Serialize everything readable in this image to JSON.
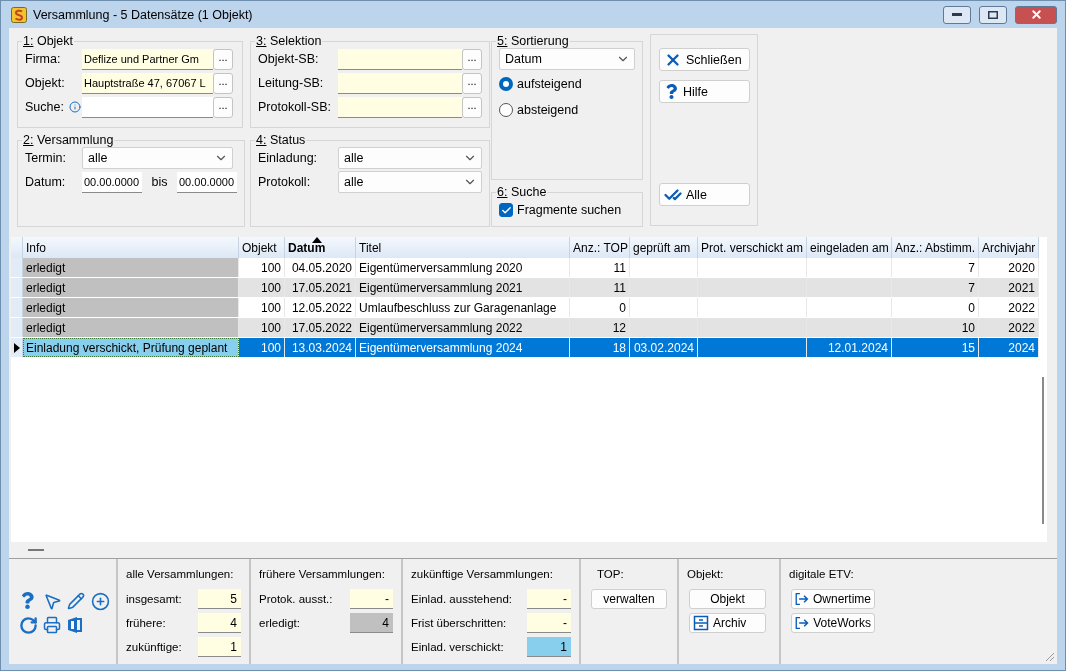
{
  "window": {
    "title": "Versammlung - 5 Datensätze (1 Objekt)"
  },
  "groups": [
    {
      "title": "1: Objekt",
      "rows": [
        {
          "kind": "lookup",
          "label": "Firma:",
          "value": "Deflize und Partner Gm",
          "browse": "...",
          "color": "#fffde2"
        },
        {
          "kind": "lookup",
          "label": "Objekt:",
          "value": "Hauptstraße 47, 67067 L",
          "browse": "...",
          "color": "#fffde2"
        },
        {
          "kind": "lookup",
          "label": "Suche:",
          "info": true,
          "browse": "...",
          "color": "#ffffff"
        }
      ]
    },
    {
      "title": "2: Versammlung",
      "rows": [
        {
          "kind": "dropdown",
          "label": "Termin:",
          "value": "alle"
        },
        {
          "kind": "daterange",
          "label": "Datum:",
          "from": "00.00.0000",
          "separator": "bis",
          "to": "00.00.0000"
        }
      ]
    },
    {
      "title": "3: Selektion",
      "rows": [
        {
          "kind": "lookup",
          "label": "Objekt-SB:",
          "browse": "...",
          "color": "#fffde2"
        },
        {
          "kind": "lookup",
          "label": "Leitung-SB:",
          "browse": "...",
          "color": "#fffde2"
        },
        {
          "kind": "lookup",
          "label": "Protokoll-SB:",
          "browse": "...",
          "color": "#fffde2"
        }
      ]
    },
    {
      "title": "4: Status",
      "rows": [
        {
          "kind": "dropdown",
          "label": "Einladung:",
          "value": "alle"
        },
        {
          "kind": "dropdown",
          "label": "Protokoll:",
          "value": "alle"
        }
      ]
    }
  ],
  "sort": {
    "title": "5: Sortierung",
    "value": "Datum",
    "options": [
      {
        "label": "aufsteigend",
        "selected": true
      },
      {
        "label": "absteigend",
        "selected": false
      }
    ]
  },
  "search": {
    "title": "6: Suche",
    "label": "Fragmente suchen",
    "checked": true
  },
  "actions": [
    {
      "kind": "close",
      "label": "Schließen"
    },
    {
      "kind": "help",
      "label": "Hilfe"
    },
    {
      "kind": "check",
      "label": "Alle"
    }
  ],
  "table": {
    "columns": [
      {
        "label": "Info",
        "sorted": false
      },
      {
        "label": "Objekt",
        "sorted": false
      },
      {
        "label": "Datum",
        "sorted": true
      },
      {
        "label": "Titel",
        "sorted": false
      },
      {
        "label": "Anz.: TOP",
        "sorted": false
      },
      {
        "label": "geprüft am",
        "sorted": false
      },
      {
        "label": "Prot. verschickt am",
        "sorted": false
      },
      {
        "label": "eingeladen am",
        "sorted": false
      },
      {
        "label": "Anz.: Abstimm.",
        "sorted": false
      },
      {
        "label": "Archivjahr",
        "sorted": false
      }
    ],
    "rows": [
      {
        "selected": false,
        "color": "#c0c0c0",
        "cells": [
          "erledigt",
          "100",
          "04.05.2020",
          "Eigentümerversammlung 2020",
          "11",
          null,
          null,
          null,
          "7",
          "2020"
        ]
      },
      {
        "selected": false,
        "color": "#c0c0c0",
        "cells": [
          "erledigt",
          "100",
          "17.05.2021",
          "Eigentümerversammlung 2021",
          "11",
          null,
          null,
          null,
          "7",
          "2021"
        ]
      },
      {
        "selected": false,
        "color": "#c0c0c0",
        "cells": [
          "erledigt",
          "100",
          "12.05.2022",
          "Umlaufbeschluss zur Garagenanlage",
          "0",
          null,
          null,
          null,
          "0",
          "2022"
        ]
      },
      {
        "selected": false,
        "color": "#c0c0c0",
        "cells": [
          "erledigt",
          "100",
          "17.05.2022",
          "Eigentümerversammlung 2022",
          "12",
          null,
          null,
          null,
          "10",
          "2022"
        ]
      },
      {
        "selected": true,
        "color": "#87cfec",
        "cells": [
          "Einladung verschickt, Prüfung geplant",
          "100",
          "13.03.2024",
          "Eigentümerversammlung 2024",
          "18",
          "03.02.2024",
          null,
          "12.01.2024",
          "15",
          "2024"
        ]
      }
    ]
  },
  "stats": [
    {
      "title": "alle Versammlungen:",
      "rows": [
        {
          "label": "insgesamt:",
          "value": "5",
          "color": "#fffde2"
        },
        {
          "label": "frühere:",
          "value": "4",
          "color": "#fffde2"
        },
        {
          "label": "zukünftige:",
          "value": "1",
          "color": "#fffde2"
        }
      ]
    },
    {
      "title": "frühere Versammlungen:",
      "rows": [
        {
          "label": "Protok. ausst.:",
          "value": "-",
          "color": "#fffde2"
        },
        {
          "label": "erledigt:",
          "value": "4",
          "color": "#c0c0c0"
        }
      ]
    },
    {
      "title": "zukünftige Versammlungen:",
      "rows": [
        {
          "label": "Einlad. ausstehend:",
          "value": "-",
          "color": "#fffde2"
        },
        {
          "label": "Frist überschritten:",
          "value": "-",
          "color": "#fffde2"
        },
        {
          "label": "Einlad. verschickt:",
          "value": "1",
          "color": "#87cfec"
        }
      ]
    }
  ],
  "button_groups": [
    {
      "title": "TOP:",
      "buttons": [
        {
          "kind": "plain",
          "label": "verwalten"
        }
      ]
    },
    {
      "title": "Objekt:",
      "buttons": [
        {
          "kind": "plain",
          "label": "Objekt"
        },
        {
          "kind": "archive",
          "label": "Archiv"
        }
      ]
    },
    {
      "title": "digitale ETV:",
      "buttons": [
        {
          "kind": "enter",
          "label": "Ownertime"
        },
        {
          "kind": "enter",
          "label": "VoteWorks"
        }
      ]
    }
  ]
}
